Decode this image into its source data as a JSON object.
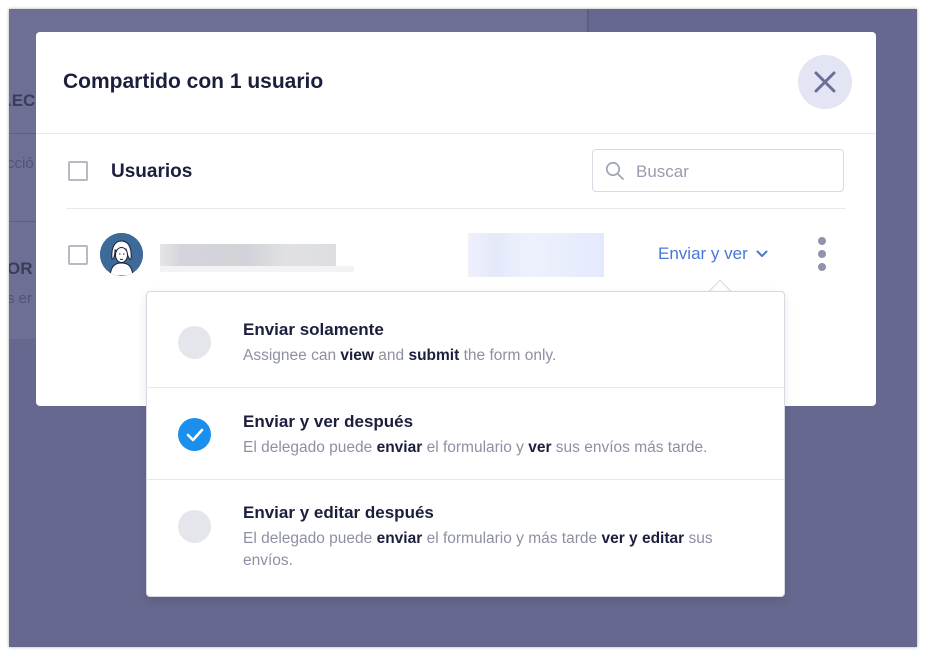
{
  "background": {
    "fragments": [
      ".EC",
      "cció",
      "OR",
      "s er"
    ]
  },
  "modal": {
    "title": "Compartido con 1 usuario",
    "close_icon": "close-icon",
    "users_header": "Usuarios",
    "search": {
      "placeholder": "Buscar",
      "icon": "search-icon"
    },
    "user_row": {
      "permission_label": "Enviar y ver",
      "dropdown_icon": "chevron-down-icon",
      "more_icon": "more-vertical-icon"
    }
  },
  "popover": {
    "options": [
      {
        "title": "Enviar solamente",
        "desc_parts": [
          "Assignee can ",
          "view",
          " and ",
          "submit",
          " the form only."
        ],
        "selected": false
      },
      {
        "title": "Enviar y ver después",
        "desc_parts": [
          "El delegado puede ",
          "enviar",
          " el formulario y ",
          "ver",
          " sus envíos más tarde."
        ],
        "selected": true
      },
      {
        "title": "Enviar y editar después",
        "desc_parts": [
          "El delegado puede ",
          "enviar",
          " el formulario y más tarde ",
          "ver y editar",
          " sus envíos."
        ],
        "selected": false
      }
    ]
  },
  "colors": {
    "overlay": "#66688f",
    "accent": "#4777d8",
    "check": "#1a8fee"
  }
}
